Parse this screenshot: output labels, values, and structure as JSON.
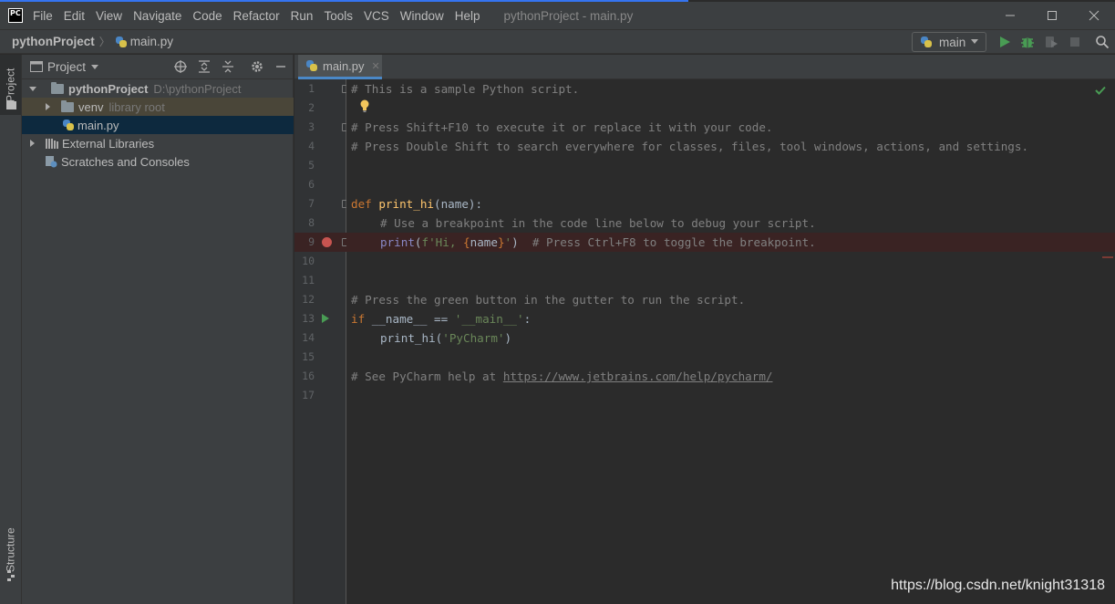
{
  "window": {
    "title": "pythonProject - main.py",
    "app_logo_text": "PC",
    "menu": [
      "File",
      "Edit",
      "View",
      "Navigate",
      "Code",
      "Refactor",
      "Run",
      "Tools",
      "VCS",
      "Window",
      "Help"
    ]
  },
  "navbar": {
    "project": "pythonProject",
    "file": "main.py",
    "run_config": "main"
  },
  "left_stripe": {
    "project_tab": "Project",
    "structure_tab": "Structure"
  },
  "project_panel": {
    "title": "Project",
    "tree": [
      {
        "label": "pythonProject",
        "hint": "D:\\pythonProject"
      },
      {
        "label": "venv",
        "hint": "library root"
      },
      {
        "label": "main.py",
        "hint": ""
      },
      {
        "label": "External Libraries",
        "hint": ""
      },
      {
        "label": "Scratches and Consoles",
        "hint": ""
      }
    ]
  },
  "editor": {
    "tab": "main.py",
    "line_numbers": [
      "1",
      "2",
      "3",
      "4",
      "5",
      "6",
      "7",
      "8",
      "9",
      "10",
      "11",
      "12",
      "13",
      "14",
      "15",
      "16",
      "17"
    ],
    "lines": {
      "l1": "# This is a sample Python script.",
      "l3": "# Press Shift+F10 to execute it or replace it with your code.",
      "l4": "# Press Double Shift to search everywhere for classes, files, tool windows, actions, and settings.",
      "l7_kw": "def ",
      "l7_fn": "print_hi",
      "l7_rest": "(name):",
      "l8": "# Use a breakpoint in the code line below to debug your script.",
      "l9_builtin": "print",
      "l9_open": "(",
      "l9_str1": "f'Hi, ",
      "l9_brace1": "{",
      "l9_var": "name",
      "l9_brace2": "}",
      "l9_str2": "'",
      "l9_close": ")  ",
      "l9_comment": "# Press Ctrl+F8 to toggle the breakpoint.",
      "l12": "# Press the green button in the gutter to run the script.",
      "l13_kw": "if ",
      "l13_rest": "__name__ == ",
      "l13_str": "'__main__'",
      "l13_colon": ":",
      "l14_fn": "print_hi(",
      "l14_str": "'PyCharm'",
      "l14_close": ")",
      "l16_text": "# See PyCharm help at ",
      "l16_link": "https://www.jetbrains.com/help/pycharm/"
    }
  },
  "watermark": "https://blog.csdn.net/knight31318",
  "colors": {
    "comment": "#808080",
    "keyword": "#cc7832",
    "function": "#ffc66d",
    "string": "#6a8759",
    "builtin": "#8888c6"
  }
}
